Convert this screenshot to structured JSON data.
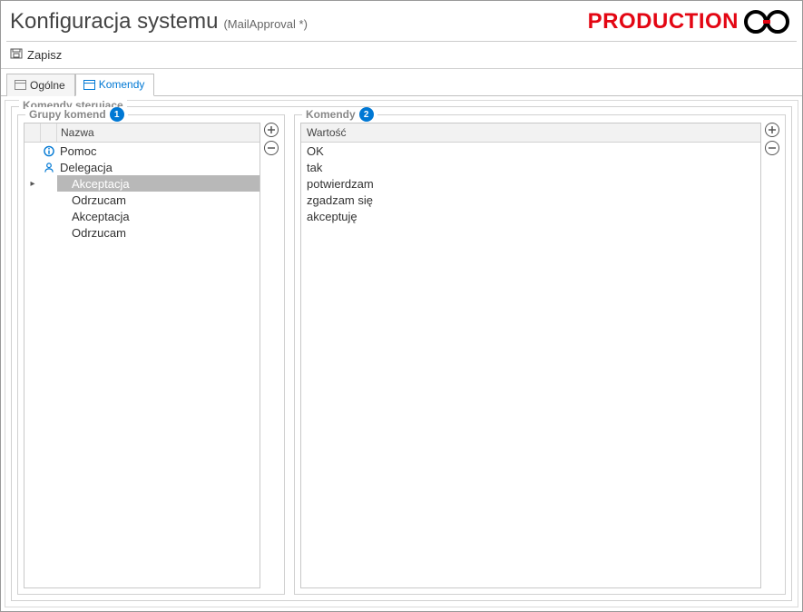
{
  "title": {
    "main": "Konfiguracja systemu",
    "sub": "(MailApproval *)",
    "env_label": "PRODUCTION"
  },
  "toolbar": {
    "save": "Zapisz"
  },
  "tabs": {
    "general": "Ogólne",
    "commands": "Komendy"
  },
  "fieldset": {
    "legend": "Komendy sterujące"
  },
  "panels": {
    "groups": {
      "legend": "Grupy komend",
      "badge": "1",
      "header": "Nazwa",
      "items": [
        {
          "name": "Pomoc",
          "icon": "info",
          "selected": false,
          "child": false
        },
        {
          "name": "Delegacja",
          "icon": "person",
          "selected": false,
          "child": false
        },
        {
          "name": "Akceptacja",
          "icon": "",
          "selected": true,
          "child": true,
          "expander": "▸"
        },
        {
          "name": "Odrzucam",
          "icon": "",
          "selected": false,
          "child": true
        },
        {
          "name": "Akceptacja",
          "icon": "",
          "selected": false,
          "child": true
        },
        {
          "name": "Odrzucam",
          "icon": "",
          "selected": false,
          "child": true
        }
      ]
    },
    "commands": {
      "legend": "Komendy",
      "badge": "2",
      "header": "Wartość",
      "items": [
        "OK",
        "tak",
        "potwierdzam",
        "zgadzam się",
        "akceptuję"
      ]
    }
  }
}
